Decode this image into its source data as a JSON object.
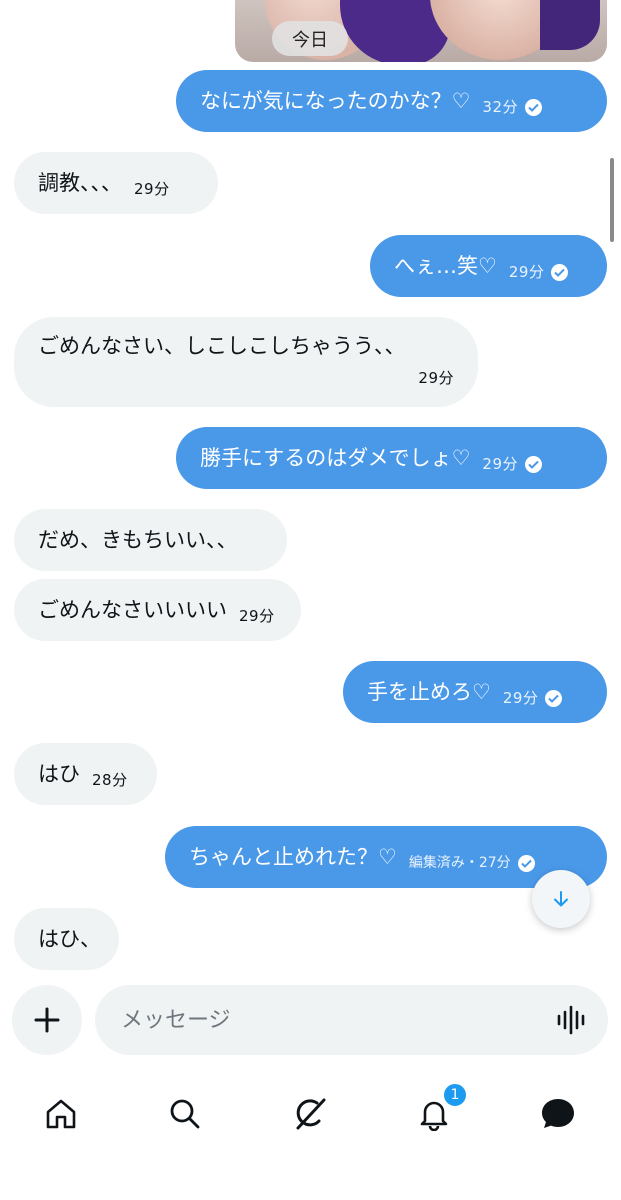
{
  "media": {
    "date_label": "今日"
  },
  "messages": [
    {
      "dir": "out",
      "text": "なにが気になったのかな？♡",
      "time": "32分",
      "read": true
    },
    {
      "dir": "in",
      "text": "調教、、、",
      "time": "29分"
    },
    {
      "dir": "out",
      "text": "へぇ…笑♡",
      "time": "29分",
      "read": true
    },
    {
      "dir": "in",
      "text": "ごめんなさい、しこしこしちゃうう、、",
      "time": "29分"
    },
    {
      "dir": "out",
      "text": "勝手にするのはダメでしょ♡",
      "time": "29分",
      "read": true
    },
    {
      "dir": "in",
      "text": "だめ、きもちいい、、",
      "time": ""
    },
    {
      "dir": "in",
      "text": "ごめんなさいいいい",
      "time": "29分"
    },
    {
      "dir": "out",
      "text": "手を止めろ♡",
      "time": "29分",
      "read": true
    },
    {
      "dir": "in",
      "text": "はひ",
      "time": "28分"
    },
    {
      "dir": "out",
      "text": "ちゃんと止めれた？♡",
      "time": "編集済み・27分",
      "read": true
    },
    {
      "dir": "in",
      "text": "はひ、",
      "time": ""
    }
  ],
  "composer": {
    "placeholder": "メッセージ"
  },
  "tabbar": {
    "items": [
      {
        "id": "home",
        "icon": "home-icon"
      },
      {
        "id": "search",
        "icon": "search-icon"
      },
      {
        "id": "grok",
        "icon": "grok-icon"
      },
      {
        "id": "notifications",
        "icon": "bell-icon",
        "badge": "1"
      },
      {
        "id": "messages",
        "icon": "chat-bubble-icon"
      }
    ]
  },
  "colors": {
    "outgoing_bubble": "#4a99e9",
    "incoming_bubble": "#eff3f4",
    "badge": "#1d9bf0"
  }
}
